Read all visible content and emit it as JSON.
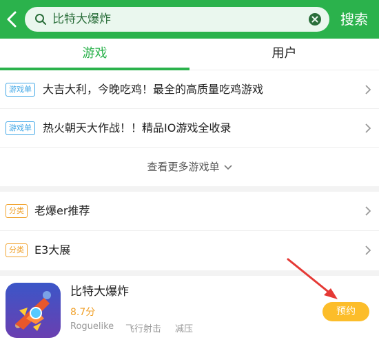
{
  "header": {
    "search_query": "比特大爆炸",
    "search_button": "搜索"
  },
  "tabs": [
    {
      "label": "游戏",
      "active": true
    },
    {
      "label": "用户",
      "active": false
    }
  ],
  "game_lists": [
    {
      "tag": "游戏单",
      "title": "大吉大利，今晚吃鸡！最全的高质量吃鸡游戏"
    },
    {
      "tag": "游戏单",
      "title": "热火朝天大作战！！精品IO游戏全收录"
    }
  ],
  "more_game_lists": "查看更多游戏单",
  "categories": [
    {
      "tag": "分类",
      "title": "老爆er推荐"
    },
    {
      "tag": "分类",
      "title": "E3大展"
    }
  ],
  "app": {
    "name": "比特大爆炸",
    "score": "8.7分",
    "tags": [
      "Roguelike",
      "飞行射击",
      "减压"
    ],
    "action_button": "预约"
  },
  "colors": {
    "brand_green": "#2bb24c",
    "tag_blue": "#3fa6e6",
    "tag_orange": "#f0a12b",
    "reserve_yellow": "#fcbd2a",
    "annotation_red": "#e53935"
  }
}
